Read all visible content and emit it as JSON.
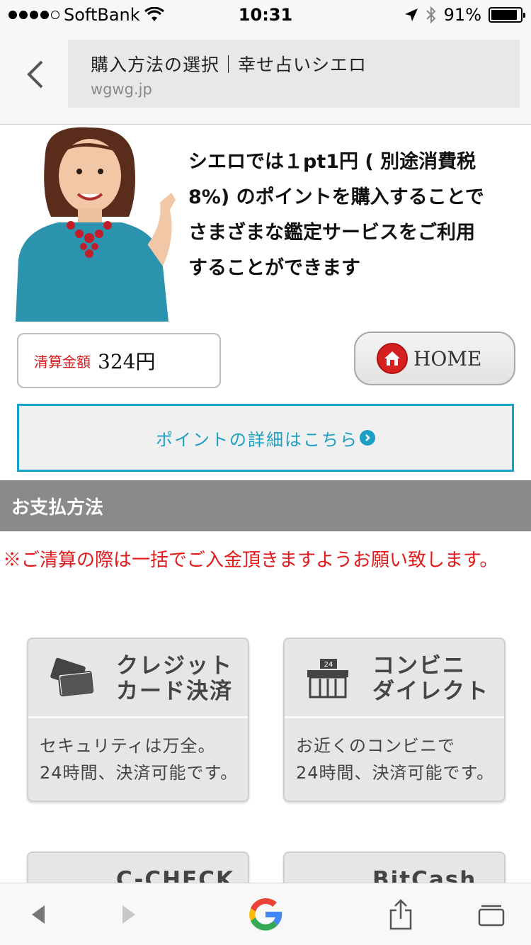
{
  "status_bar": {
    "carrier": "SoftBank",
    "time": "10:31",
    "battery": "91%",
    "battery_level": 0.91
  },
  "browser": {
    "page_title": "購入方法の選択｜幸せ占いシエロ",
    "domain": "wgwg.jp"
  },
  "hero": {
    "lines": [
      "シエロでは１pt1円 ( 別途消費税",
      "8%) のポイントを購入することで",
      "さまざまな鑑定サービスをご利用",
      "することができます"
    ]
  },
  "price": {
    "label": "清算金額",
    "value": "324円"
  },
  "home_button": {
    "label": "HOME"
  },
  "points_link": {
    "label": "ポイントの詳細はこちら"
  },
  "section": {
    "title": "お支払方法"
  },
  "notice": "※ご清算の際は一括でご入金頂きますようお願い致します。",
  "payment_methods": [
    {
      "title_line1": "クレジット",
      "title_line2": "カード決済",
      "desc_line1": "セキュリティは万全。",
      "desc_line2": "24時間、決済可能です。",
      "icon": "credit-card-icon"
    },
    {
      "title_line1": "コンビニ",
      "title_line2": "ダイレクト",
      "desc_line1": "お近くのコンビニで",
      "desc_line2": "24時間、決済可能です。",
      "icon": "convenience-store-icon",
      "store_badge": "24"
    },
    {
      "title_line1": "C-CHECK"
    },
    {
      "title_line1": "BitCash"
    }
  ],
  "colors": {
    "accent": "#16a3c8",
    "notice_red": "#e11a1a",
    "section_gray": "#8a8a8a",
    "home_red": "#d42020"
  }
}
